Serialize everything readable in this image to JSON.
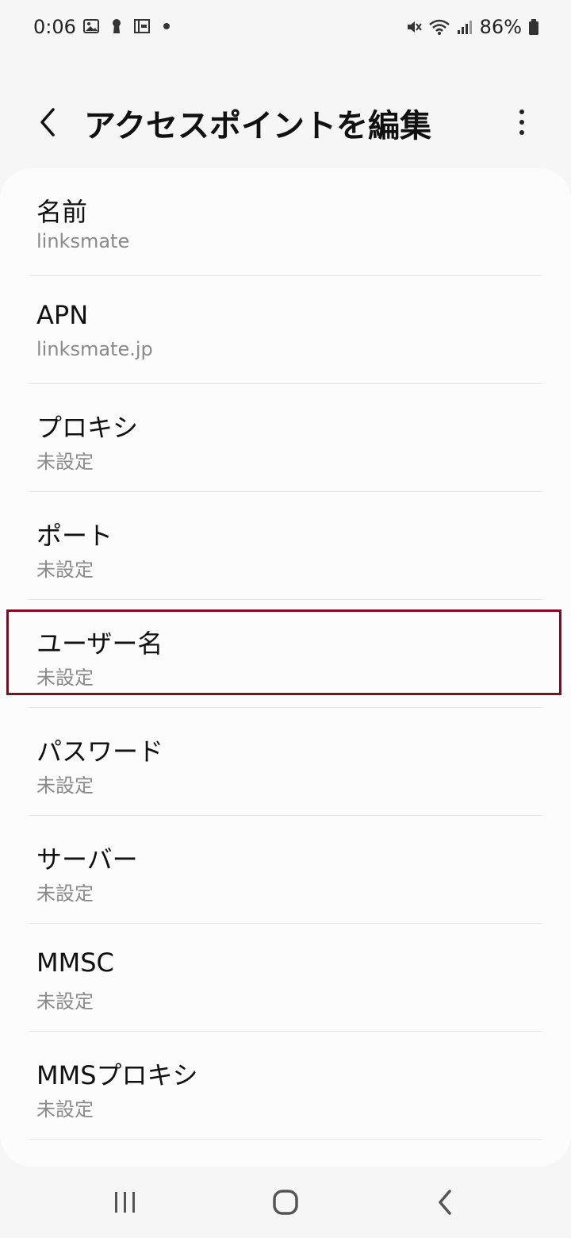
{
  "status_bar": {
    "time": "0:06",
    "battery": "86%"
  },
  "header": {
    "title": "アクセスポイントを編集"
  },
  "items": [
    {
      "title": "名前",
      "value": "linksmate"
    },
    {
      "title": "APN",
      "value": "linksmate.jp"
    },
    {
      "title": "プロキシ",
      "value": "未設定"
    },
    {
      "title": "ポート",
      "value": "未設定"
    },
    {
      "title": "ユーザー名",
      "value": "未設定"
    },
    {
      "title": "パスワード",
      "value": "未設定"
    },
    {
      "title": "サーバー",
      "value": "未設定"
    },
    {
      "title": "MMSC",
      "value": "未設定"
    },
    {
      "title": "MMSプロキシ",
      "value": "未設定"
    }
  ],
  "colors": {
    "highlight": "#7a0e22",
    "background": "#f6f6f6",
    "card": "#fcfcfc"
  }
}
